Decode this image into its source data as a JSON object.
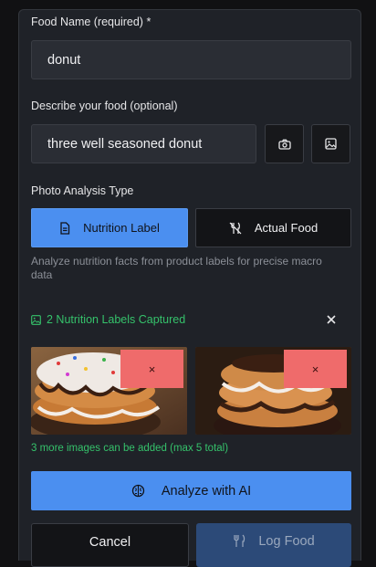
{
  "form": {
    "food_name_label": "Food Name (required) *",
    "food_name_value": "donut",
    "describe_label": "Describe your food (optional)",
    "describe_value": "three well seasoned donut",
    "analysis_type_label": "Photo Analysis Type",
    "tabs": [
      {
        "label": "Nutrition Label",
        "icon": "document-icon",
        "active": true
      },
      {
        "label": "Actual Food",
        "icon": "fork-knife-off-icon",
        "active": false
      }
    ],
    "analysis_hint": "Analyze nutrition facts from product labels for precise macro data"
  },
  "captures": {
    "status": "2 Nutrition Labels Captured",
    "remove_symbol": "×",
    "limit_note": "3 more images can be added (max 5 total)"
  },
  "actions": {
    "analyze_label": "Analyze with AI",
    "cancel_label": "Cancel",
    "log_label": "Log Food"
  },
  "colors": {
    "accent": "#4b8ff0",
    "success": "#35c26b",
    "danger": "#ef6b6b",
    "panel": "#1f2228"
  }
}
